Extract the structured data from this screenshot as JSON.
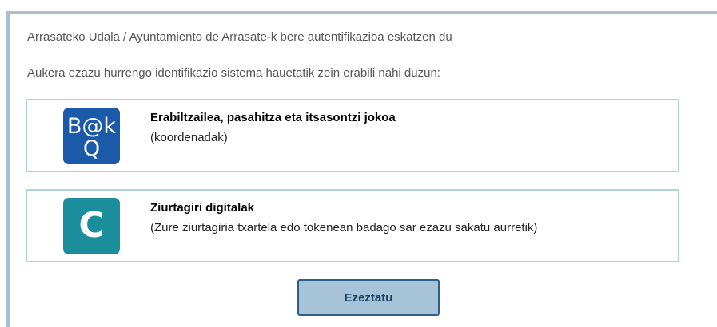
{
  "intro": {
    "line1": "Arrasateko Udala / Ayuntamiento de Arrasate-k bere autentifikazioa eskatzen du",
    "line2": "Aukera ezazu hurrengo identifikazio sistema hauetatik zein erabili nahi duzun:"
  },
  "options": [
    {
      "icon": "bakq-logo-icon",
      "logo_text_top": "B@k",
      "logo_text_bottom": "Q",
      "title": "Erabiltzailea, pasahitza eta itsasontzi jokoa",
      "description": "(koordenadak)",
      "color": "#1a5aa8"
    },
    {
      "icon": "certificate-logo-icon",
      "logo_text": "C",
      "title": "Ziurtagiri digitalak",
      "description": "(Zure ziurtagiria txartela edo tokenean badago sar ezazu sakatu aurretik)",
      "color": "#1a8f9b"
    }
  ],
  "cancel_button": {
    "label": "Ezeztatu"
  },
  "colors": {
    "frame_border": "#a7bfd3",
    "option_border": "#a9d4e0",
    "button_bg": "#a6c3d8",
    "button_border": "#2e5f86"
  }
}
